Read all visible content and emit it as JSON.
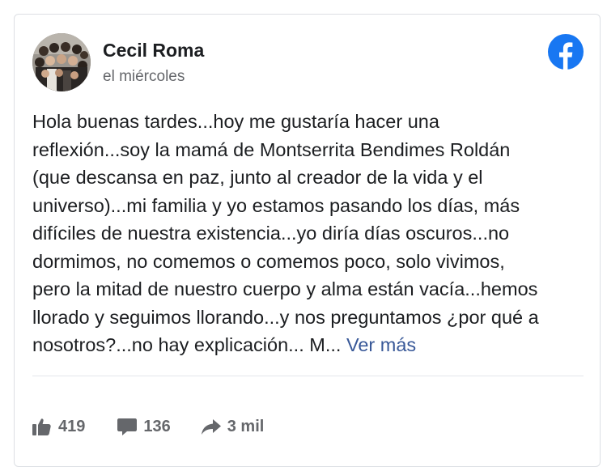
{
  "post": {
    "author": "Cecil Roma",
    "timestamp": "el miércoles",
    "lines": [
      "Hola buenas tardes...hoy me gustaría hacer una",
      "reflexión...soy la mamá de Montserrita Bendimes Roldán",
      "(que descansa en paz, junto al creador de la vida y el",
      "universo)...mi familia y yo estamos pasando los días, más",
      "difíciles de nuestra existencia...yo diría días oscuros...no",
      "dormimos, no comemos o comemos poco, solo vivimos,",
      "pero la mitad de nuestro cuerpo y alma están vacía...hemos",
      "llorado y seguimos llorando...y nos preguntamos ¿por qué a",
      "nosotros?...no hay explicación... M..."
    ],
    "see_more": "Ver más"
  },
  "stats": {
    "likes": "419",
    "comments": "136",
    "shares": "3 mil"
  },
  "icons": {
    "brand": "facebook-logo-icon",
    "like": "thumbs-up-icon",
    "comment": "comment-bubble-icon",
    "share": "share-arrow-icon"
  },
  "colors": {
    "facebook_blue": "#1877f2",
    "link_blue": "#385898",
    "text": "#1c1e21",
    "secondary_text": "#65676b"
  }
}
